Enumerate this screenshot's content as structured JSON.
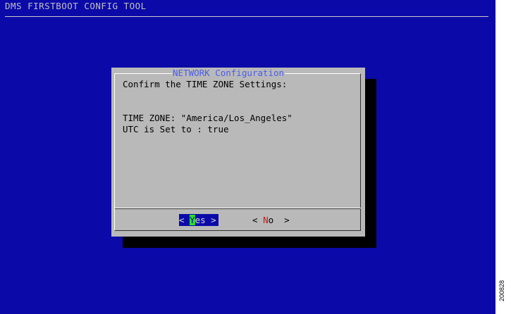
{
  "app": {
    "title": "DMS FIRSTBOOT CONFIG TOOL"
  },
  "dialog": {
    "title": "NETWORK Configuration",
    "prompt": "Confirm the TIME ZONE Settings:",
    "timezone_line": "TIME ZONE: \"America/Los_Angeles\"",
    "utc_line": "UTC is Set to : true"
  },
  "buttons": {
    "yes": {
      "open": "< ",
      "hotkey": "Y",
      "rest": "es",
      "close": " >"
    },
    "no": {
      "open": "< ",
      "hotkey": "N",
      "rest": "o",
      "close": "  >"
    }
  },
  "figure_id": "200828",
  "colors": {
    "background": "#0b0aa8",
    "dialog": "#b9b9b9",
    "title_accent": "#4a5cf0",
    "hotkey_highlight": "#28e028",
    "hotkey_red": "#c01818"
  }
}
